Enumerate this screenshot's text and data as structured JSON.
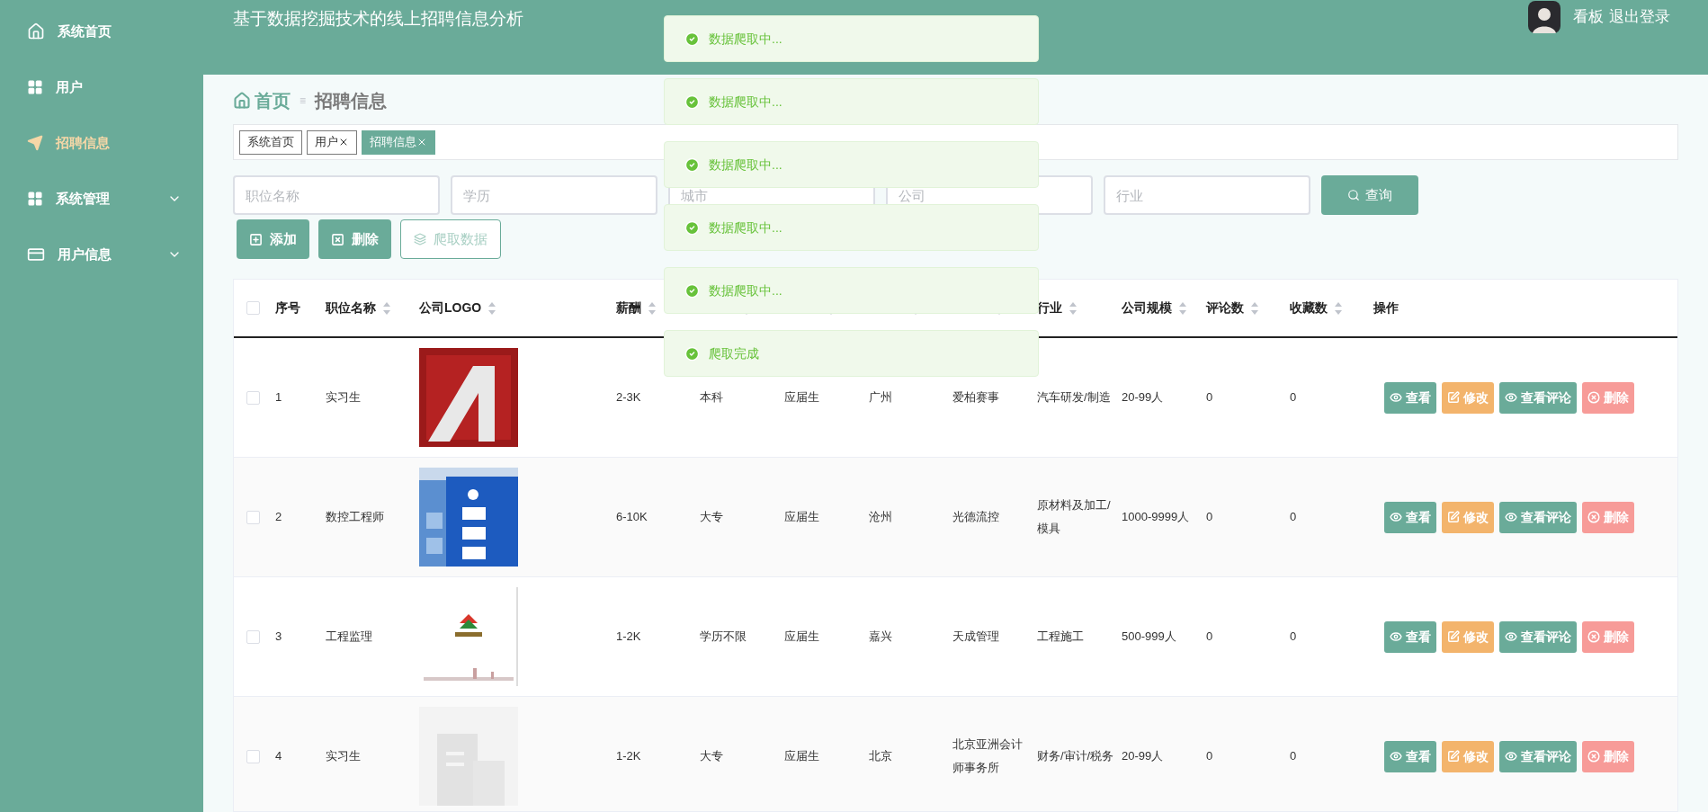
{
  "sidebar": {
    "items": [
      {
        "label": "系统首页",
        "selected": false,
        "expandable": false
      },
      {
        "label": "用户",
        "selected": false,
        "expandable": false
      },
      {
        "label": "招聘信息",
        "selected": true,
        "expandable": false
      },
      {
        "label": "系统管理",
        "selected": false,
        "expandable": true
      },
      {
        "label": "用户信息",
        "selected": false,
        "expandable": true
      }
    ]
  },
  "header": {
    "title": "基于数据挖掘技术的线上招聘信息分析",
    "links": [
      "看板",
      "退出登录"
    ]
  },
  "breadcrumb": {
    "home": "首页",
    "separator": "≡",
    "current": "招聘信息"
  },
  "tags": [
    {
      "label": "系统首页",
      "closable": false,
      "selected": false
    },
    {
      "label": "用户",
      "closable": true,
      "selected": false
    },
    {
      "label": "招聘信息",
      "closable": true,
      "selected": true
    }
  ],
  "search": {
    "fields": [
      {
        "placeholder": "职位名称"
      },
      {
        "placeholder": "学历"
      },
      {
        "placeholder": "城市"
      },
      {
        "placeholder": "公司"
      },
      {
        "placeholder": "行业"
      }
    ],
    "button": "查询"
  },
  "actions": [
    {
      "label": "添加",
      "kind": "add"
    },
    {
      "label": "删除",
      "kind": "delete"
    },
    {
      "label": "爬取数据",
      "kind": "crawl"
    }
  ],
  "table": {
    "all_checked": false,
    "columns": [
      {
        "label": "序号",
        "sortable": false
      },
      {
        "label": "职位名称",
        "sortable": true
      },
      {
        "label": "公司LOGO",
        "sortable": true
      },
      {
        "label": "薪酬",
        "sortable": true
      },
      {
        "sortable": true
      },
      {
        "sortable": true
      },
      {
        "sortable": true
      },
      {
        "sortable": true
      },
      {
        "label": "行业",
        "sortable": true
      },
      {
        "label": "公司规模",
        "sortable": true
      },
      {
        "label": "评论数",
        "sortable": true
      },
      {
        "label": "收藏数",
        "sortable": true
      },
      {
        "label": "操作",
        "sortable": false
      }
    ],
    "rows": [
      {
        "checked": false,
        "cells": [
          "1",
          "实习生",
          {
            "kind": "picture"
          },
          "2-3K",
          "本科",
          "应届生",
          "广州",
          "爱柏赛事",
          "汽车研发/制造",
          "20-99人",
          "0",
          "0"
        ],
        "buttons": [
          {
            "label": "查看",
            "kind": "view"
          },
          {
            "label": "修改",
            "kind": "edit"
          },
          {
            "label": "查看评论",
            "kind": "view"
          },
          {
            "label": "删除",
            "kind": "delete"
          }
        ]
      },
      {
        "checked": false,
        "cells": [
          "2",
          "数控工程师",
          {
            "kind": "picture"
          },
          "6-10K",
          "大专",
          "应届生",
          "沧州",
          "光德流控",
          "原材料及加工/模具",
          "1000-9999人",
          "0",
          "0"
        ],
        "buttons": [
          {
            "label": "查看",
            "kind": "view"
          },
          {
            "label": "修改",
            "kind": "edit"
          },
          {
            "label": "查看评论",
            "kind": "view"
          },
          {
            "label": "删除",
            "kind": "delete"
          }
        ]
      },
      {
        "checked": false,
        "cells": [
          "3",
          "工程监理",
          {
            "kind": "picture"
          },
          "1-2K",
          "学历不限",
          "应届生",
          "嘉兴",
          "天成管理",
          "工程施工",
          "500-999人",
          "0",
          "0"
        ],
        "buttons": [
          {
            "label": "查看",
            "kind": "view"
          },
          {
            "label": "修改",
            "kind": "edit"
          },
          {
            "label": "查看评论",
            "kind": "view"
          },
          {
            "label": "删除",
            "kind": "delete"
          }
        ]
      },
      {
        "checked": false,
        "cells": [
          "4",
          "实习生",
          {
            "kind": "picture"
          },
          "1-2K",
          "大专",
          "应届生",
          "北京",
          "北京亚洲会计师事务所",
          "财务/审计/税务",
          "20-99人",
          "0",
          "0"
        ],
        "buttons": [
          {
            "label": "查看",
            "kind": "view"
          },
          {
            "label": "修改",
            "kind": "edit"
          },
          {
            "label": "查看评论",
            "kind": "view"
          },
          {
            "label": "删除",
            "kind": "delete"
          }
        ]
      }
    ]
  },
  "toasts": [
    "数据爬取中...",
    "数据爬取中...",
    "数据爬取中...",
    "数据爬取中...",
    "数据爬取中...",
    "爬取完成"
  ]
}
